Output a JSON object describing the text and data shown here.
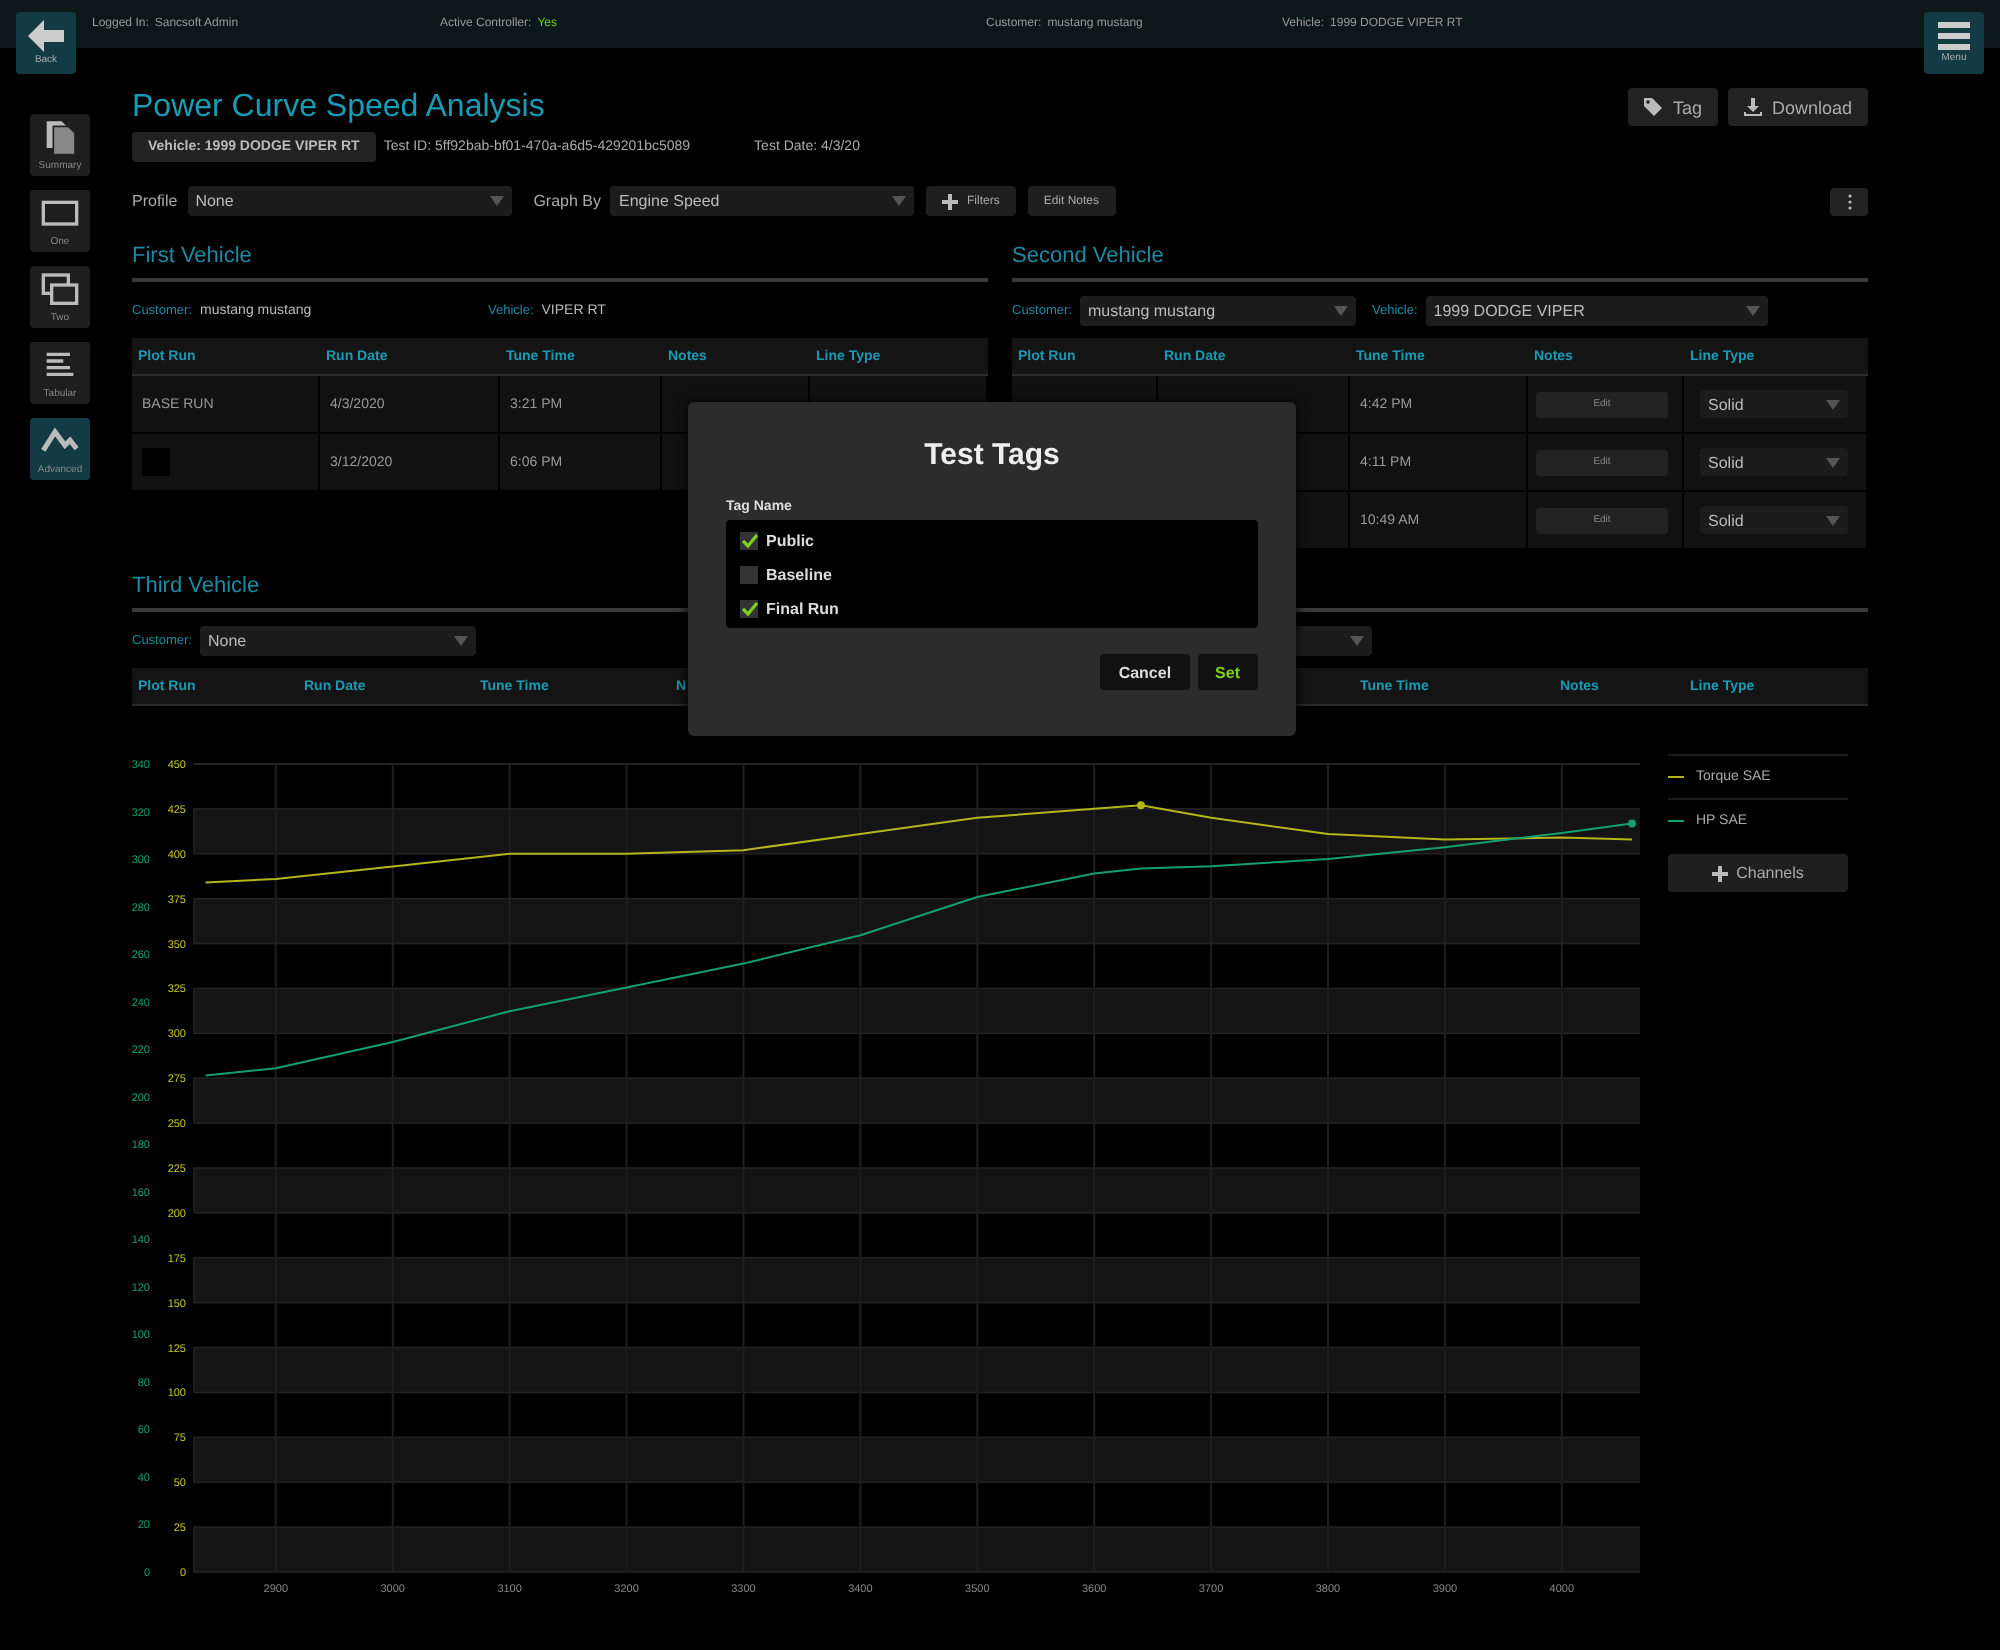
{
  "top_bar": {
    "back_label": "Back",
    "menu_label": "Menu",
    "info": [
      {
        "label": "Logged In:",
        "value": "Sancsoft Admin",
        "kind": "plain"
      },
      {
        "label": "Active Controller:",
        "value": "Yes",
        "kind": "status"
      },
      {
        "label": "Customer:",
        "value": "mustang mustang",
        "kind": "plain"
      },
      {
        "label": "Vehicle:",
        "value": "1999 DODGE VIPER RT",
        "kind": "plain"
      }
    ]
  },
  "sidebar": {
    "items": [
      {
        "label": "Summary",
        "selected": false
      },
      {
        "label": "One",
        "selected": false
      },
      {
        "label": "Two",
        "selected": false
      },
      {
        "label": "Tabular",
        "selected": false
      },
      {
        "label": "Advanced",
        "selected": true
      }
    ]
  },
  "header": {
    "title": "Power Curve Speed Analysis",
    "tag_button": "Tag",
    "download_button": "Download",
    "vehicle_chip": "Vehicle: 1999 DODGE VIPER RT",
    "test_id": "Test ID: 5ff92bab-bf01-470a-a6d5-429201bc5089",
    "test_date": "Test Date: 4/3/20"
  },
  "toolbar": {
    "profile_label": "Profile",
    "profile_value": "None",
    "graph_by_label": "Graph By",
    "graph_by_value": "Engine Speed",
    "filters_button": "Filters",
    "edit_notes_button": "Edit Notes"
  },
  "first_vehicle": {
    "title": "First Vehicle",
    "customer_label": "Customer:",
    "customer": "mustang mustang",
    "vehicle_label": "Vehicle:",
    "vehicle": "VIPER RT",
    "columns": [
      "Plot Run",
      "Run Date",
      "Tune Time",
      "Notes",
      "Line Type"
    ],
    "rows": [
      {
        "kind": "name",
        "plot_run": "BASE RUN",
        "run_date": "4/3/2020",
        "tune_time": "3:21 PM"
      },
      {
        "kind": "swatch",
        "run_date": "3/12/2020",
        "tune_time": "6:06 PM"
      }
    ]
  },
  "second_vehicle": {
    "title": "Second Vehicle",
    "customer_label": "Customer:",
    "customer": "mustang mustang",
    "vehicle_label": "Vehicle:",
    "vehicle": "1999 DODGE VIPER",
    "columns": [
      "Plot Run",
      "Run Date",
      "Tune Time",
      "Notes",
      "Line Type"
    ],
    "rows": [
      {
        "tune_time": "4:42 PM",
        "notes_button": "Edit",
        "line_type": "Solid"
      },
      {
        "tune_time": "4:11 PM",
        "notes_button": "Edit",
        "line_type": "Solid"
      },
      {
        "tune_time": "10:49 AM",
        "notes_button": "Edit",
        "line_type": "Solid"
      }
    ]
  },
  "third_vehicle": {
    "title": "Third Vehicle",
    "customer_label": "Customer:",
    "customer": "None",
    "columns": [
      "Plot Run",
      "Run Date",
      "Tune Time",
      "N",
      "Tune Time",
      "Notes",
      "Line Type"
    ]
  },
  "chart": {
    "channels_button": "Channels",
    "chart_data": {
      "type": "line",
      "grid": true,
      "x": [
        2840,
        2900,
        3000,
        3100,
        3200,
        3300,
        3400,
        3500,
        3600,
        3640,
        3700,
        3800,
        3900,
        4000,
        4060
      ],
      "xlim": [
        2830,
        4072
      ],
      "xticks": [
        2900,
        3000,
        3100,
        3200,
        3300,
        3400,
        3500,
        3600,
        3700,
        3800,
        3900,
        4000
      ],
      "ylim": [
        0,
        450
      ],
      "yticks": [
        0,
        25,
        50,
        75,
        100,
        125,
        150,
        175,
        200,
        225,
        250,
        275,
        300,
        325,
        350,
        375,
        400,
        425,
        450
      ],
      "y2lim": [
        0,
        340
      ],
      "y2ticks": [
        0,
        20,
        40,
        60,
        80,
        100,
        120,
        140,
        160,
        180,
        200,
        220,
        240,
        260,
        280,
        300,
        320,
        340
      ],
      "series": [
        {
          "name": "Torque SAE",
          "color": "#b5b51c",
          "axis": "y",
          "values": [
            384,
            386,
            393,
            400,
            400,
            402,
            411,
            420,
            425,
            427,
            420,
            411,
            408,
            409,
            408
          ]
        },
        {
          "name": "HP SAE",
          "color": "#13a06e",
          "axis": "y2",
          "values": [
            209,
            212,
            223,
            236,
            246,
            256,
            268,
            284,
            294,
            296,
            297,
            300,
            305,
            311,
            315
          ]
        }
      ]
    }
  },
  "modal": {
    "title": "Test Tags",
    "label": "Tag Name",
    "tags": [
      {
        "label": "Public",
        "checked": true
      },
      {
        "label": "Baseline",
        "checked": false
      },
      {
        "label": "Final Run",
        "checked": true
      }
    ],
    "cancel_button": "Cancel",
    "set_button": "Set"
  }
}
